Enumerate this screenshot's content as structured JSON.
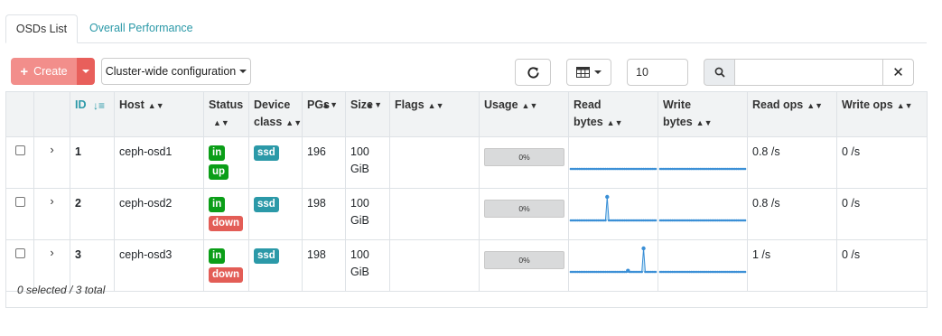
{
  "tabs": [
    {
      "label": "OSDs List",
      "active": true
    },
    {
      "label": "Overall Performance",
      "active": false
    }
  ],
  "toolbar": {
    "create_label": "Create",
    "cluster_config_label": "Cluster-wide configuration",
    "page_size": "10",
    "search_placeholder": "",
    "refresh_icon": "refresh-icon",
    "columns_icon": "table-columns-icon",
    "search_icon": "search-icon",
    "clear_icon": "close-icon"
  },
  "colors": {
    "accent": "#2b99a8",
    "create_button": "#f28e8b",
    "status_in_up": "#0b9e18",
    "status_down": "#e35d56",
    "sparkline": "#3a8fd6"
  },
  "table": {
    "headers": {
      "id": "ID",
      "host": "Host",
      "status": "Status",
      "device_class": "Device class",
      "pgs": "PGs",
      "size": "Size",
      "flags": "Flags",
      "usage": "Usage",
      "read_bytes": "Read bytes",
      "write_bytes": "Write bytes",
      "read_ops": "Read ops",
      "write_ops": "Write ops"
    },
    "rows": [
      {
        "id": "1",
        "host": "ceph-osd1",
        "status": [
          "in",
          "up"
        ],
        "device_class": "ssd",
        "pgs": "196",
        "size": "100 GiB",
        "flags": "",
        "usage": "0%",
        "read_bytes_series": [
          0,
          0,
          0,
          0,
          0,
          0,
          0,
          0,
          0,
          0,
          0,
          0,
          0,
          0,
          0,
          0,
          0,
          0,
          0,
          0,
          0,
          0,
          0,
          0,
          0,
          0,
          0,
          0,
          0,
          0,
          0,
          0,
          0,
          0,
          0,
          0,
          0,
          0,
          0,
          0,
          0,
          0,
          0,
          0,
          0,
          0,
          0,
          0,
          0,
          0
        ],
        "write_bytes_series": [
          0,
          0,
          0,
          0,
          0,
          0,
          0,
          0,
          0,
          0,
          0,
          0,
          0,
          0,
          0,
          0,
          0,
          0,
          0,
          0,
          0,
          0,
          0,
          0,
          0,
          0,
          0,
          0,
          0,
          0,
          0,
          0,
          0,
          0,
          0,
          0,
          0,
          0,
          0,
          0,
          0,
          0,
          0,
          0,
          0,
          0,
          0,
          0,
          0,
          0
        ],
        "read_ops": "0.8 /s",
        "write_ops": "0 /s"
      },
      {
        "id": "2",
        "host": "ceph-osd2",
        "status": [
          "in",
          "down"
        ],
        "device_class": "ssd",
        "pgs": "198",
        "size": "100 GiB",
        "flags": "",
        "usage": "0%",
        "read_bytes_series": [
          0,
          0,
          0,
          0,
          0,
          0,
          0,
          0,
          0,
          0,
          0,
          0,
          0,
          0,
          0,
          0,
          0,
          0,
          0,
          0,
          0,
          1,
          0,
          0,
          0,
          0,
          0,
          0,
          0,
          0,
          0,
          0,
          0,
          0,
          0,
          0,
          0,
          0,
          0,
          0,
          0,
          0,
          0,
          0,
          0,
          0,
          0,
          0,
          0,
          0
        ],
        "write_bytes_series": [
          0,
          0,
          0,
          0,
          0,
          0,
          0,
          0,
          0,
          0,
          0,
          0,
          0,
          0,
          0,
          0,
          0,
          0,
          0,
          0,
          0,
          0,
          0,
          0,
          0,
          0,
          0,
          0,
          0,
          0,
          0,
          0,
          0,
          0,
          0,
          0,
          0,
          0,
          0,
          0,
          0,
          0,
          0,
          0,
          0,
          0,
          0,
          0,
          0,
          0
        ],
        "read_ops": "0.8 /s",
        "write_ops": "0 /s"
      },
      {
        "id": "3",
        "host": "ceph-osd3",
        "status": [
          "in",
          "down"
        ],
        "device_class": "ssd",
        "pgs": "198",
        "size": "100 GiB",
        "flags": "",
        "usage": "0%",
        "read_bytes_series": [
          0,
          0,
          0,
          0,
          0,
          0,
          0,
          0,
          0,
          0,
          0,
          0,
          0,
          0,
          0,
          0,
          0,
          0,
          0,
          0,
          0,
          0,
          0,
          0,
          0,
          0,
          0,
          0,
          0,
          0,
          0,
          0,
          0,
          0.05,
          0,
          0,
          0,
          0,
          0,
          0,
          0,
          0,
          1,
          0,
          0,
          0,
          0,
          0,
          0,
          0
        ],
        "write_bytes_series": [
          0,
          0,
          0,
          0,
          0,
          0,
          0,
          0,
          0,
          0,
          0,
          0,
          0,
          0,
          0,
          0,
          0,
          0,
          0,
          0,
          0,
          0,
          0,
          0,
          0,
          0,
          0,
          0,
          0,
          0,
          0,
          0,
          0,
          0,
          0,
          0,
          0,
          0,
          0,
          0,
          0,
          0,
          0,
          0,
          0,
          0,
          0,
          0,
          0,
          0
        ],
        "read_ops": "1 /s",
        "write_ops": "0 /s"
      }
    ]
  },
  "footer": {
    "summary": "0 selected / 3 total"
  }
}
